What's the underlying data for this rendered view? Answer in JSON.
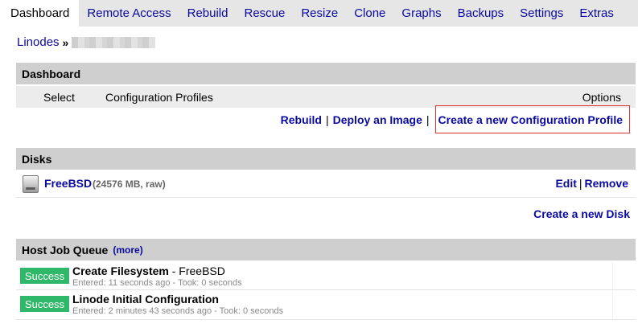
{
  "tabs": [
    {
      "label": "Dashboard",
      "active": true
    },
    {
      "label": "Remote Access"
    },
    {
      "label": "Rebuild"
    },
    {
      "label": "Rescue"
    },
    {
      "label": "Resize"
    },
    {
      "label": "Clone"
    },
    {
      "label": "Graphs"
    },
    {
      "label": "Backups"
    },
    {
      "label": "Settings"
    },
    {
      "label": "Extras"
    }
  ],
  "breadcrumb": {
    "root": "Linodes",
    "sep": "»"
  },
  "dashboard": {
    "title": "Dashboard",
    "col_select": "Select",
    "col_profiles": "Configuration Profiles",
    "col_options": "Options",
    "action_rebuild": "Rebuild",
    "action_deploy": "Deploy an Image",
    "action_create_profile": "Create a new Configuration Profile",
    "sep": "|"
  },
  "disks": {
    "title": "Disks",
    "items": [
      {
        "name": "FreeBSD",
        "meta": "(24576 MB, raw)",
        "edit": "Edit",
        "remove": "Remove"
      }
    ],
    "create_label": "Create a new Disk"
  },
  "jobs": {
    "title": "Host Job Queue",
    "more": "(more)",
    "items": [
      {
        "status": "Success",
        "title": "Create Filesystem",
        "detail": " - FreeBSD",
        "sub": "Entered: 11 seconds ago - Took: 0 seconds"
      },
      {
        "status": "Success",
        "title": "Linode Initial Configuration",
        "detail": "",
        "sub": "Entered: 2 minutes 43 seconds ago - Took: 0 seconds"
      }
    ]
  },
  "colors": {
    "link": "#0a0a9e",
    "success": "#2fb86a",
    "highlight": "#e03030",
    "header_bg": "#cfcfcf"
  }
}
